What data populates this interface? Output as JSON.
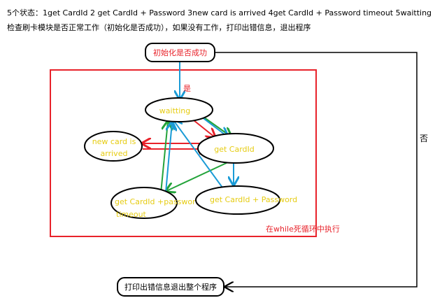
{
  "header": {
    "line1": "5个状态：1get CardId     2 get CardId + Password  3new card is arrived    4get CardId + Password timeout       5waitting",
    "line2": "检查刷卡模块是否正常工作（初始化是否成功），如果没有工作，打印出错信息，退出程序"
  },
  "nodes": {
    "init": "初始化是否成功",
    "waitting": "waitting",
    "new_card_line1": "new card is",
    "new_card_line2": "arrived",
    "get_cardid": "get CardId",
    "timeout_line1": "get CardId +password",
    "timeout_line2": "timeout",
    "password": "get CardId + Password",
    "exit": "打印出错信息退出整个程序"
  },
  "labels": {
    "yes": "是",
    "no": "否",
    "loop": "在while死循环中执行"
  },
  "colors": {
    "red": "#e8222a",
    "blue": "#1a9bd6",
    "green": "#23a33a",
    "yellow": "#e6cc12",
    "black": "#000000"
  }
}
